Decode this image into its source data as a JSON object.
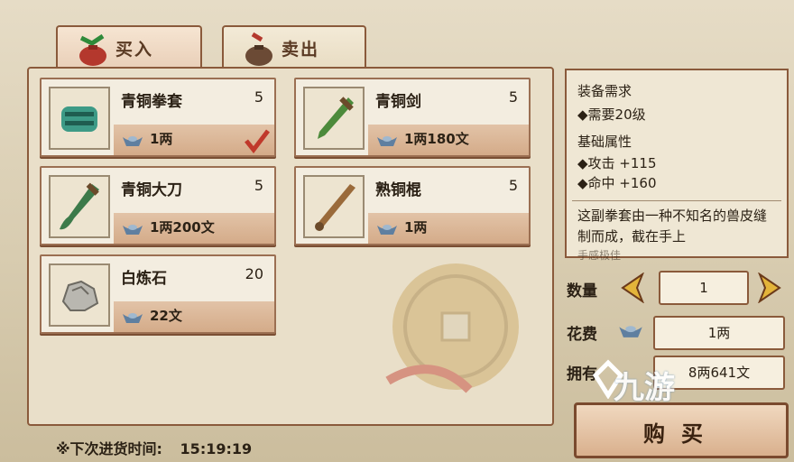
{
  "tabs": [
    {
      "label": "买入",
      "active": true
    },
    {
      "label": "卖出",
      "active": false
    }
  ],
  "items": [
    {
      "name": "青铜拳套",
      "qty": "5",
      "price": "1两",
      "icon": "bronze-gauntlet-icon",
      "selected": true
    },
    {
      "name": "青铜剑",
      "qty": "5",
      "price": "1两180文",
      "icon": "bronze-sword-icon",
      "selected": false
    },
    {
      "name": "青铜大刀",
      "qty": "5",
      "price": "1两200文",
      "icon": "bronze-broadsword-icon",
      "selected": false
    },
    {
      "name": "熟铜棍",
      "qty": "5",
      "price": "1两",
      "icon": "copper-staff-icon",
      "selected": false
    },
    {
      "name": "白炼石",
      "qty": "20",
      "price": "22文",
      "icon": "white-stone-icon",
      "selected": false
    }
  ],
  "details": {
    "req_title": "装备需求",
    "req_level": "◆需要20级",
    "attr_title": "基础属性",
    "attack": "◆攻击 +115",
    "hit": "◆命中 +160",
    "desc": "这副拳套由一种不知名的兽皮缝制而成，截在手上",
    "desc_cut": "手感极佳"
  },
  "purchase": {
    "qty_label": "数量",
    "qty_value": "1",
    "cost_label": "花费",
    "cost_value": "1两",
    "own_label": "拥有",
    "own_value": "8两641文",
    "buy_label": "购买"
  },
  "restock": {
    "label": "※下次进货时间:",
    "time": "15:19:19"
  },
  "watermark": "九游",
  "colors": {
    "border": "#8a5a3b",
    "price_bar": "#d4ab89",
    "check": "#c0392b",
    "ingot": "#5f7fa0"
  }
}
